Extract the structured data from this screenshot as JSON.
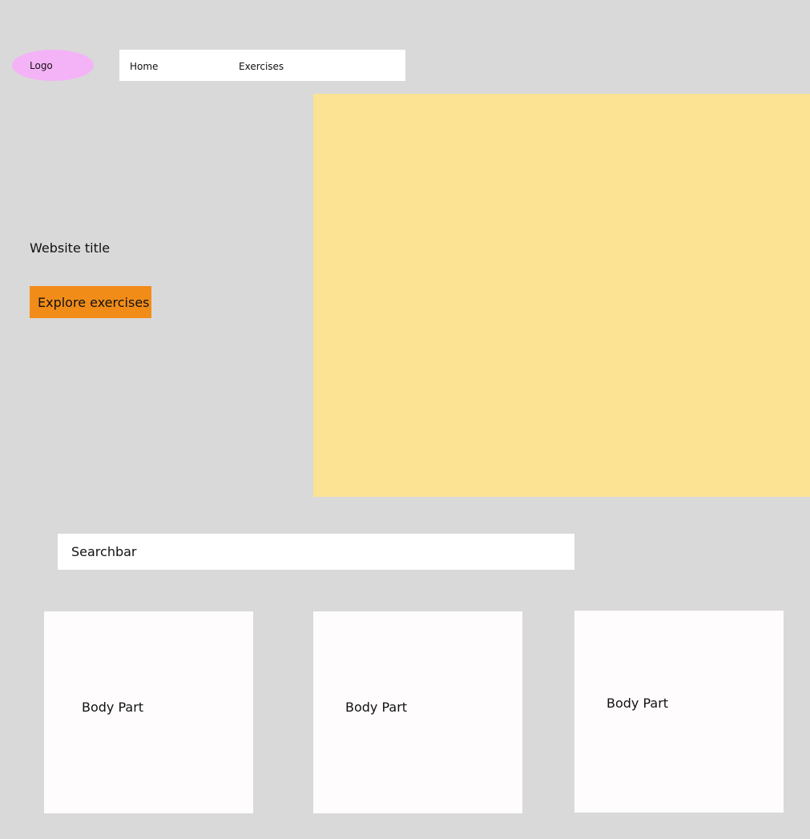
{
  "header": {
    "logo_label": "Logo",
    "nav": [
      {
        "label": "Home"
      },
      {
        "label": "Exercises"
      }
    ]
  },
  "hero": {
    "title": "Website title",
    "cta_label": "Explore exercises",
    "image_color": "#fbe393"
  },
  "search": {
    "placeholder": "Searchbar"
  },
  "cards": [
    {
      "label": "Body Part"
    },
    {
      "label": "Body Part"
    },
    {
      "label": "Body Part"
    }
  ],
  "colors": {
    "background": "#d9d9d9",
    "logo": "#f4b3f6",
    "cta": "#f28c18",
    "surface": "#ffffff"
  }
}
